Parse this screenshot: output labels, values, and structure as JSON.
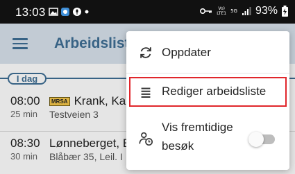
{
  "status_bar": {
    "time": "13:03",
    "battery": "93%",
    "network_label_top": "Vo)",
    "network_label_bottom": "LTE1",
    "network_5g": "5G"
  },
  "app_bar": {
    "title": "Arbeidsliste",
    "menu_icon": "hamburger-menu-icon"
  },
  "day_header": {
    "label": "I dag"
  },
  "visits": [
    {
      "time": "08:00",
      "duration": "25 min",
      "tag": "MRSA",
      "name": "Krank, Kal",
      "address": "Testveien 3"
    },
    {
      "time": "08:30",
      "duration": "30 min",
      "tag": "",
      "name": "Lønneberget, E",
      "address": "Blåbær 35, Leil. I"
    }
  ],
  "popup_menu": {
    "items": [
      {
        "label": "Oppdater",
        "icon": "refresh-icon"
      },
      {
        "label": "Rediger arbeidsliste",
        "icon": "list-icon",
        "highlighted": true
      },
      {
        "label_line1": "Vis fremtidige",
        "label_line2": "besøk",
        "icon": "person-clock-icon",
        "toggle_on": false
      }
    ]
  },
  "colors": {
    "accent": "#3f6f95",
    "appbar_bg": "#d9e2ec",
    "highlight": "#e0262b",
    "mrsa_badge": "#f6c84a"
  }
}
